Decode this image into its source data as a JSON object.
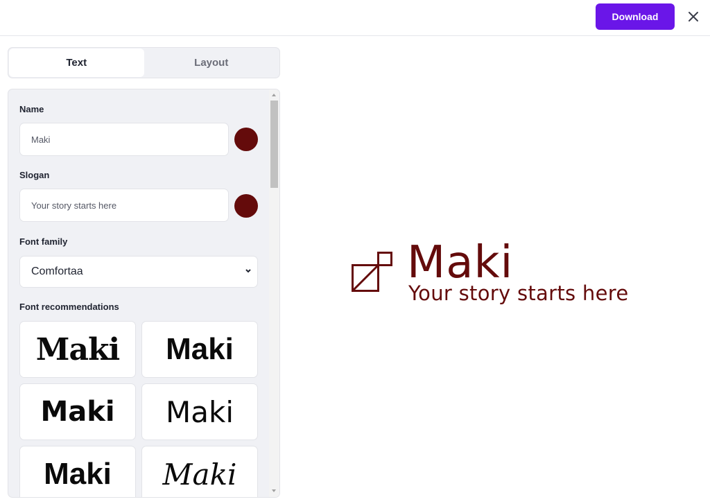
{
  "header": {
    "download_label": "Download",
    "close_icon": "close-icon",
    "accent_color": "#6a16e8"
  },
  "tabs": [
    {
      "label": "Text",
      "active": true
    },
    {
      "label": "Layout",
      "active": false
    }
  ],
  "form": {
    "name": {
      "label": "Name",
      "value": "Maki",
      "color": "#640b0b"
    },
    "slogan": {
      "label": "Slogan",
      "value": "Your story starts here",
      "color": "#640b0b"
    },
    "font_family": {
      "label": "Font family",
      "selected": "Comfortaa"
    },
    "recommendations": {
      "label": "Font recommendations",
      "items": [
        {
          "text": "Maki",
          "style": "serif"
        },
        {
          "text": "Maki",
          "style": "bold-sans"
        },
        {
          "text": "Maki",
          "style": "bold-sans-rounded"
        },
        {
          "text": "Maki",
          "style": "sans"
        },
        {
          "text": "Maki",
          "style": "bold-sans-heavy"
        },
        {
          "text": "Maki",
          "style": "script"
        }
      ]
    }
  },
  "preview": {
    "logo_icon": "squares-diagonal-icon",
    "name": "Maki",
    "slogan": "Your story starts here",
    "color": "#640b0b"
  }
}
